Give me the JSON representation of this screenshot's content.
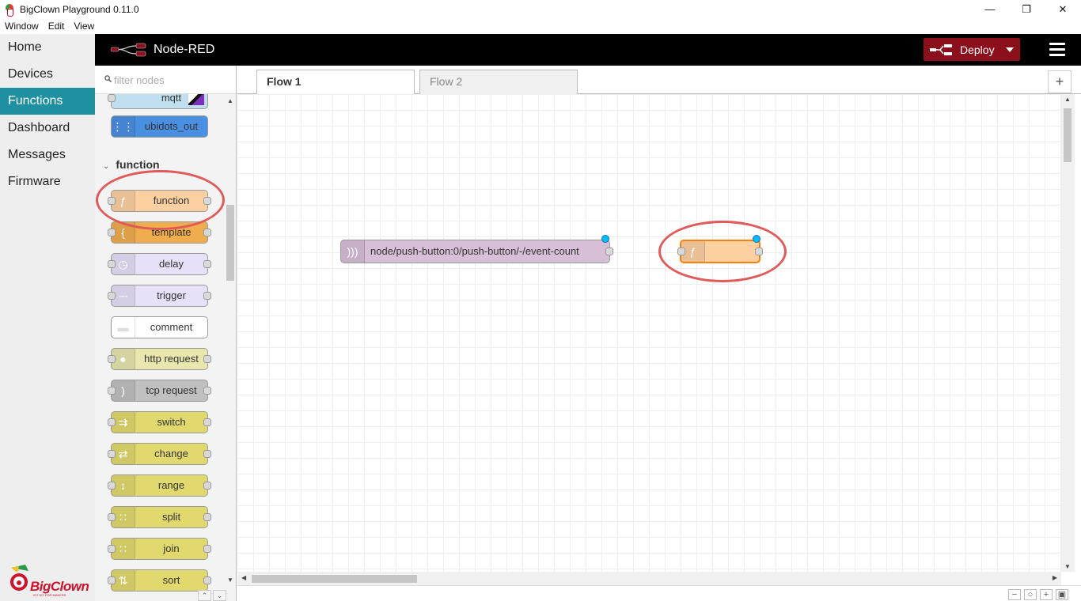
{
  "window": {
    "title": "BigClown Playground 0.11.0",
    "minimize": "—",
    "restore": "❐",
    "close": "✕"
  },
  "menu": [
    "Window",
    "Edit",
    "View"
  ],
  "appnav": {
    "items": [
      "Home",
      "Devices",
      "Functions",
      "Dashboard",
      "Messages",
      "Firmware"
    ],
    "active": "Functions",
    "brand": "BigClown",
    "brand_sub": "IOT KIT FOR MAKERS"
  },
  "header": {
    "title": "Node-RED",
    "deploy_label": "Deploy"
  },
  "palette": {
    "search_placeholder": "filter nodes",
    "category": "function",
    "top_nodes": [
      {
        "label": "mqtt",
        "color": "#c0deed"
      },
      {
        "label": "ubidots_out",
        "color": "#4a90e2"
      }
    ],
    "nodes": [
      {
        "label": "function",
        "color": "#fdd0a2",
        "icon": "function-icon",
        "glyph": "ƒ"
      },
      {
        "label": "template",
        "color": "#f0ad4e",
        "icon": "template-icon",
        "glyph": "{"
      },
      {
        "label": "delay",
        "color": "#e6e0f8",
        "icon": "timer-icon",
        "glyph": "◷"
      },
      {
        "label": "trigger",
        "color": "#e6e0f8",
        "icon": "trigger-icon",
        "glyph": "⎓"
      },
      {
        "label": "comment",
        "color": "#ffffff",
        "icon": "comment-icon",
        "glyph": "▬"
      },
      {
        "label": "http request",
        "color": "#e7e7ae",
        "icon": "globe-icon",
        "glyph": "●"
      },
      {
        "label": "tcp request",
        "color": "#c0c0c0",
        "icon": "bridge-icon",
        "glyph": ")"
      },
      {
        "label": "switch",
        "color": "#e2d96e",
        "icon": "switch-icon",
        "glyph": "⇉"
      },
      {
        "label": "change",
        "color": "#e2d96e",
        "icon": "swap-icon",
        "glyph": "⇄"
      },
      {
        "label": "range",
        "color": "#e2d96e",
        "icon": "range-icon",
        "glyph": "↕"
      },
      {
        "label": "split",
        "color": "#e2d96e",
        "icon": "split-icon",
        "glyph": "∷"
      },
      {
        "label": "join",
        "color": "#e2d96e",
        "icon": "join-icon",
        "glyph": "∷"
      },
      {
        "label": "sort",
        "color": "#e2d96e",
        "icon": "sort-icon",
        "glyph": "⇅"
      }
    ]
  },
  "tabs": {
    "active": "Flow 1",
    "inactive": "Flow 2",
    "add": "+"
  },
  "flow": {
    "mqtt_in_label": "node/push-button:0/push-button/-/event-count",
    "mqtt_in_color": "#d8bfd8",
    "function_color": "#fdd0a2"
  },
  "zoom": {
    "out": "−",
    "reset": "○",
    "in": "+",
    "nav": "▣"
  },
  "colors": {
    "accent": "#1f8fa2",
    "deploy": "#8c101c",
    "annotation": "#e05a5a"
  }
}
